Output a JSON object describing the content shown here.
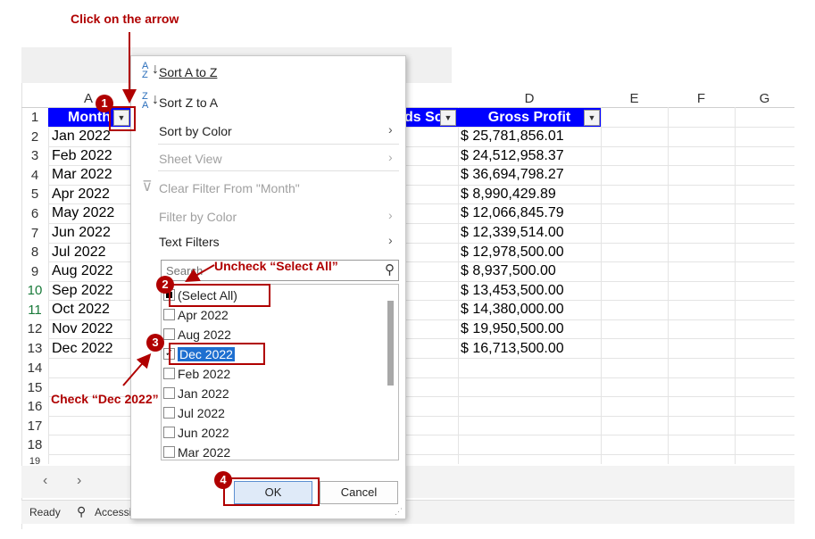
{
  "annotations": {
    "step1": "Click on the arrow",
    "step2": "Uncheck “Select All”",
    "step3": "Check “Dec 2022”",
    "badges": [
      "1",
      "2",
      "3",
      "4"
    ]
  },
  "grid": {
    "columns": [
      "A",
      "D",
      "E",
      "F",
      "G"
    ],
    "row_numbers": [
      "1",
      "2",
      "3",
      "4",
      "5",
      "6",
      "7",
      "8",
      "9",
      "10",
      "11",
      "12",
      "13",
      "14",
      "15",
      "16",
      "17",
      "18",
      "19"
    ],
    "header_month": "Month",
    "header_units": "ds So",
    "header_profit": "Gross Profit",
    "months": [
      "Jan 2022",
      "Feb 2022",
      "Mar 2022",
      "Apr 2022",
      "May 2022",
      "Jun 2022",
      "Jul 2022",
      "Aug 2022",
      "Sep 2022",
      "Oct 2022",
      "Nov 2022",
      "Dec 2022"
    ],
    "profits": [
      "$ 25,781,856.01",
      "$ 24,512,958.37",
      "$ 36,694,798.27",
      "$ 8,990,429.89",
      "$ 12,066,845.79",
      "$ 12,339,514.00",
      "$ 12,978,500.00",
      "$ 8,937,500.00",
      "$ 13,453,500.00",
      "$ 14,380,000.00",
      "$ 19,950,500.00",
      "$ 16,713,500.00"
    ]
  },
  "menu": {
    "sort_az": "Sort A to Z",
    "sort_za": "Sort Z to A",
    "sort_color": "Sort by Color",
    "sheet_view": "Sheet View",
    "clear_filter": "Clear Filter From \"Month\"",
    "filter_color": "Filter by Color",
    "text_filters": "Text Filters",
    "search_placeholder": "Search",
    "list": [
      "(Select All)",
      "Apr 2022",
      "Aug 2022",
      "Dec 2022",
      "Feb 2022",
      "Jan 2022",
      "Jul 2022",
      "Jun 2022",
      "Mar 2022"
    ],
    "ok": "OK",
    "cancel": "Cancel"
  },
  "status": {
    "ready": "Ready",
    "accessibility": "Accessi"
  },
  "colors": {
    "header_fill": "#0000ff",
    "annotation": "#b00000"
  }
}
